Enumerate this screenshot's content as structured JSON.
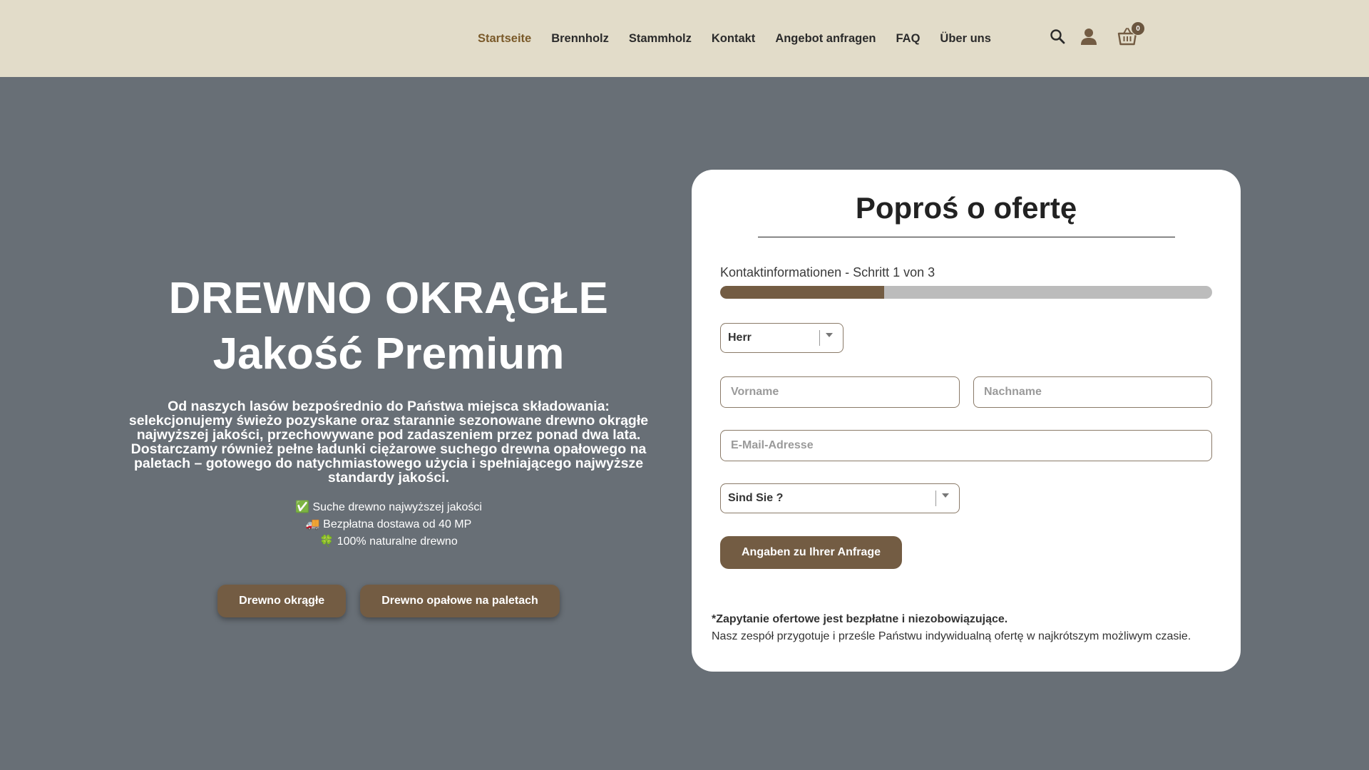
{
  "nav": {
    "items": [
      {
        "label": "Startseite",
        "active": true
      },
      {
        "label": "Brennholz",
        "active": false
      },
      {
        "label": "Stammholz",
        "active": false
      },
      {
        "label": "Kontakt",
        "active": false
      },
      {
        "label": "Angebot anfragen",
        "active": false
      },
      {
        "label": "FAQ",
        "active": false
      },
      {
        "label": "Über uns",
        "active": false
      }
    ],
    "cart_count": "0"
  },
  "hero": {
    "title": "DREWNO OKRĄGŁE",
    "subtitle": "Jakość Premium",
    "description": "Od naszych lasów bezpośrednio do Państwa miejsca składowania: selekcjonujemy świeżo pozyskane oraz starannie sezonowane drewno okrągłe najwyższej jakości, przechowywane pod zadaszeniem przez ponad dwa lata. Dostarczamy również pełne ładunki ciężarowe suchego drewna opałowego na paletach – gotowego do natychmiastowego użycia i spełniającego najwyższe standardy jakości.",
    "features": [
      {
        "icon": "✅",
        "text": "Suche drewno najwyższej jakości"
      },
      {
        "icon": "🚚",
        "text": "Bezpłatna dostawa od 40 MP"
      },
      {
        "icon": "🍀",
        "text": "100% naturalne drewno"
      }
    ],
    "buttons": {
      "round_wood": "Drewno okrągłe",
      "pallet_wood": "Drewno opałowe na paletach"
    }
  },
  "form": {
    "title": "Poproś o ofertę",
    "step_label": "Kontaktinformationen - Schritt 1 von 3",
    "progress": 0.333,
    "salutation_value": "Herr",
    "firstname_placeholder": "Vorname",
    "lastname_placeholder": "Nachname",
    "email_placeholder": "E-Mail-Adresse",
    "type_value": "Sind Sie ?",
    "submit_label": "Angaben zu Ihrer Anfrage",
    "note_bold": "*Zapytanie ofertowe jest bezpłatne i niezobowiązujące.",
    "note": "Nasz zespół przygotuje i prześle Państwu indywidualną ofertę w najkrótszym możliwym czasie."
  },
  "colors": {
    "header_bg": "#e2dcc9",
    "hero_bg": "#686f76",
    "accent_brown": "#735c43",
    "active_nav": "#7a5a2a"
  }
}
